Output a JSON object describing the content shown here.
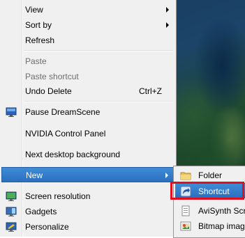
{
  "menu": {
    "view": "View",
    "sort_by": "Sort by",
    "refresh": "Refresh",
    "paste": "Paste",
    "paste_shortcut": "Paste shortcut",
    "undo_delete": "Undo Delete",
    "undo_shortcut": "Ctrl+Z",
    "pause_dreamscene": "Pause DreamScene",
    "nvidia": "NVIDIA Control Panel",
    "next_background": "Next desktop background",
    "new": "New",
    "screen_resolution": "Screen resolution",
    "gadgets": "Gadgets",
    "personalize": "Personalize"
  },
  "submenu": {
    "folder": "Folder",
    "shortcut": "Shortcut",
    "avisynth": "AviSynth Script",
    "bitmap": "Bitmap image"
  },
  "colors": {
    "highlight": "#2a6fbf",
    "annotation": "#e0101e"
  }
}
